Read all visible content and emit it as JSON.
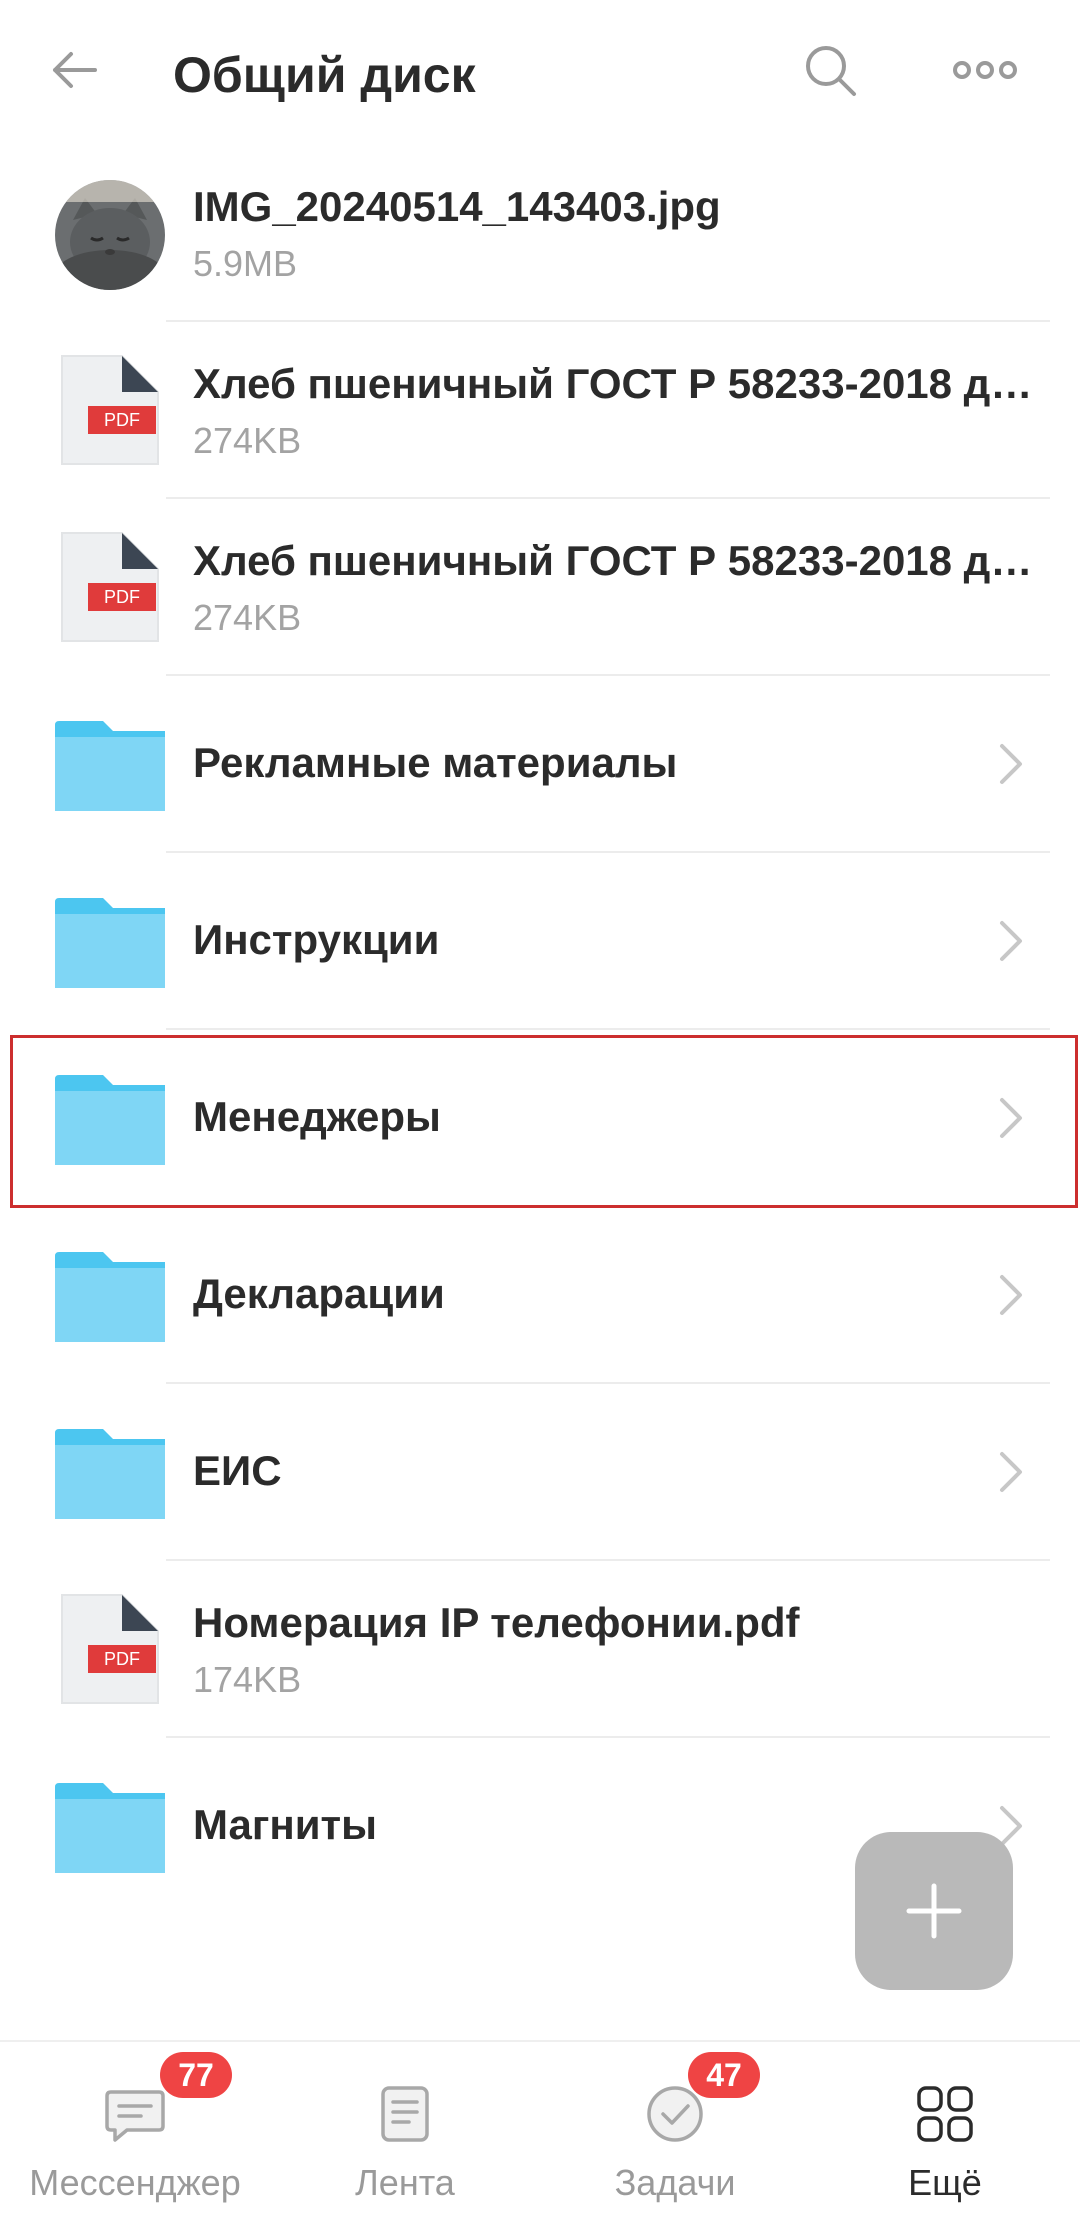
{
  "header": {
    "title": "Общий диск",
    "back_icon": "arrow-left-icon",
    "search_icon": "search-icon",
    "more_icon": "more-horizontal-icon"
  },
  "items": [
    {
      "name": "IMG_20240514_143403.jpg",
      "size": "5.9MB",
      "type": "image"
    },
    {
      "name": "Хлеб пшеничный ГОСТ Р 58233-2018 д…",
      "size": "274KB",
      "type": "pdf"
    },
    {
      "name": "Хлеб пшеничный ГОСТ Р 58233-2018 д…",
      "size": "274KB",
      "type": "pdf"
    },
    {
      "name": "Рекламные материалы",
      "type": "folder"
    },
    {
      "name": "Инструкции",
      "type": "folder"
    },
    {
      "name": "Менеджеры",
      "type": "folder",
      "highlighted": true
    },
    {
      "name": "Декларации",
      "type": "folder"
    },
    {
      "name": "ЕИС",
      "type": "folder"
    },
    {
      "name": "Номерация IP телефонии.pdf",
      "size": "174KB",
      "type": "pdf"
    },
    {
      "name": "Магниты",
      "type": "folder"
    }
  ],
  "pdf_label": "PDF",
  "fab": {
    "icon": "plus-icon"
  },
  "tabbar": {
    "tabs": [
      {
        "label": "Мессенджер",
        "badge": "77",
        "icon": "chat-icon"
      },
      {
        "label": "Лента",
        "icon": "feed-icon"
      },
      {
        "label": "Задачи",
        "badge": "47",
        "icon": "check-circle-icon"
      },
      {
        "label": "Ещё",
        "icon": "grid-icon",
        "active": true
      }
    ]
  },
  "colors": {
    "accent_folder": "#7fd6f5",
    "folder_tab": "#4cc6f0",
    "pdf_red": "#e03b3b",
    "badge_red": "#ef4444",
    "highlight_border": "#cc2e2e"
  }
}
